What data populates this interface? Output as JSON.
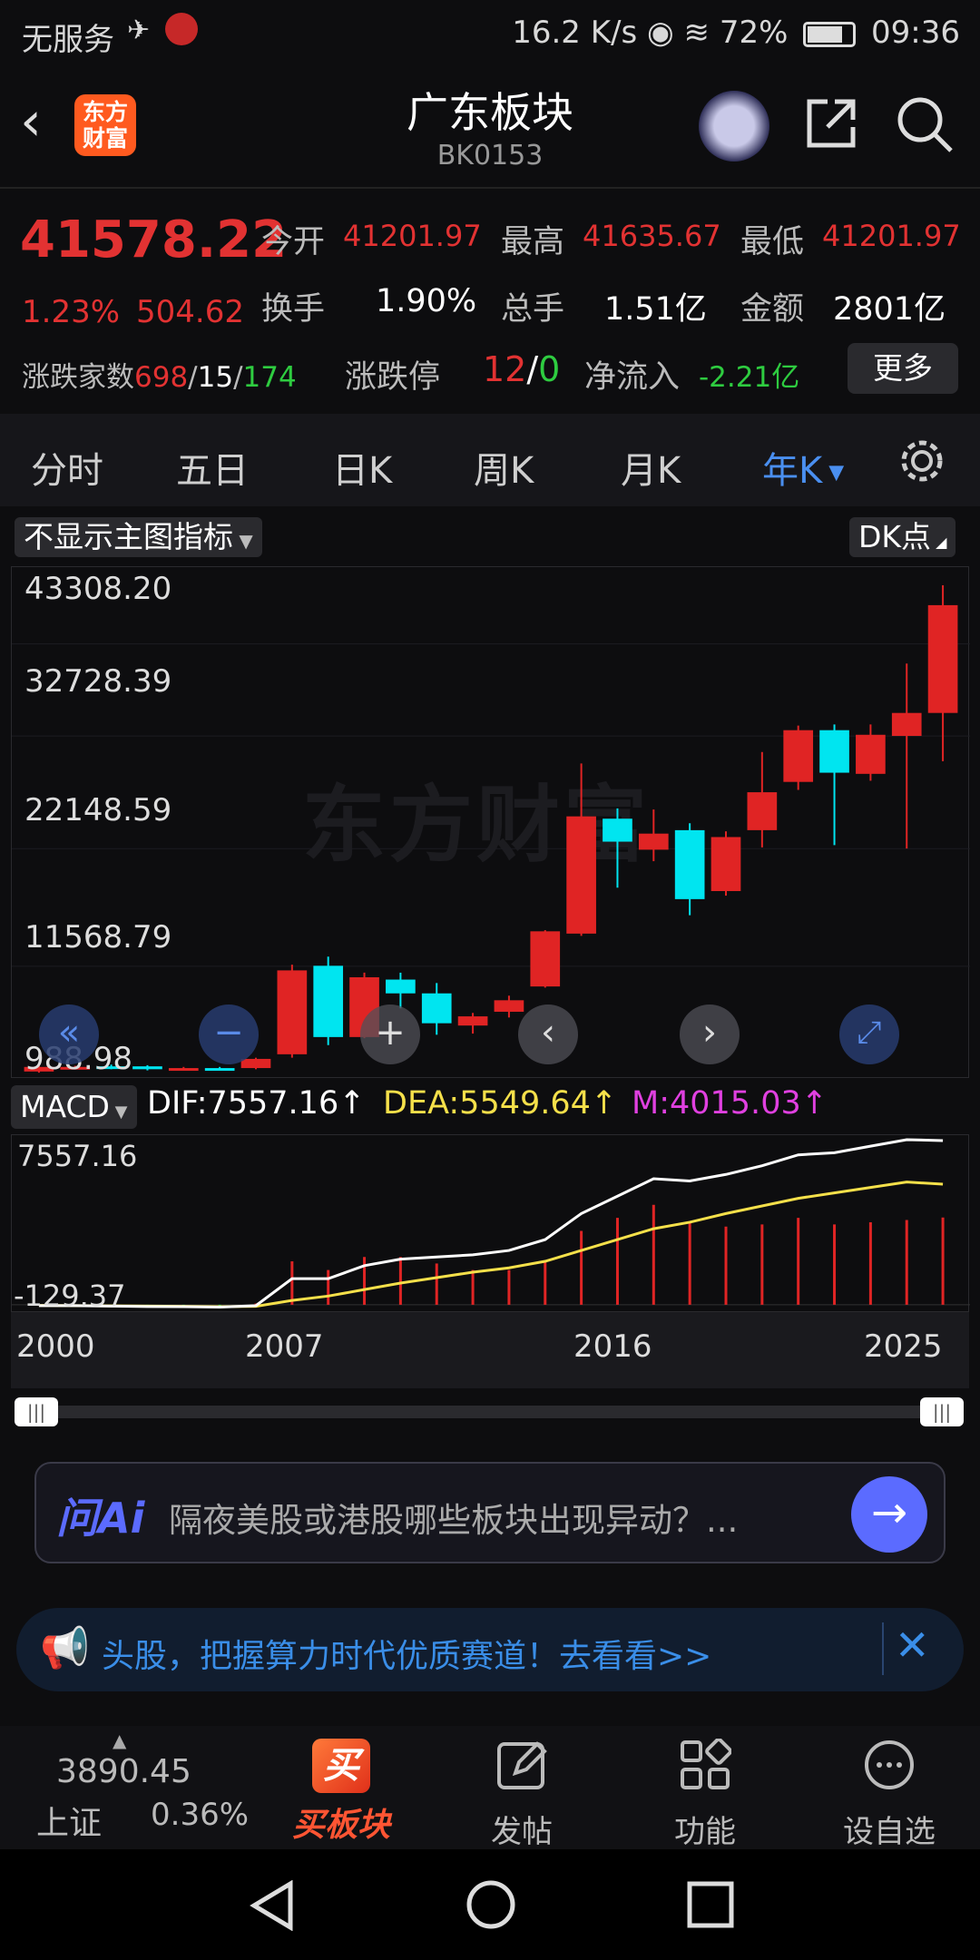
{
  "status": {
    "carrier": "无服务",
    "speed": "16.2 K/s",
    "battery": "72%",
    "time": "09:36"
  },
  "nav": {
    "logo": "东方财富",
    "title": "广东板块",
    "code": "BK0153"
  },
  "quote": {
    "price": "41578.22",
    "pct": "1.23%",
    "chg": "504.62",
    "open_label": "今开",
    "open": "41201.97",
    "high_label": "最高",
    "high": "41635.67",
    "low_label": "最低",
    "low": "41201.97",
    "turnover_label": "换手",
    "turnover": "1.90%",
    "vol_label": "总手",
    "vol": "1.51亿",
    "amt_label": "金额",
    "amt": "2801亿",
    "updown_label": "涨跌家数",
    "up": "698",
    "flat": "15",
    "down": "174",
    "limit_label": "涨跌停",
    "limit_up": "12",
    "limit_down": "0",
    "inflow_label": "净流入",
    "inflow": "-2.21亿",
    "more": "更多"
  },
  "tabs": [
    "分时",
    "五日",
    "日K",
    "周K",
    "月K",
    "年K"
  ],
  "chart": {
    "indicator_select": "不显示主图指标",
    "dk": "DK点",
    "watermark": "东方财富",
    "y_labels": [
      "43308.20",
      "32728.39",
      "22148.59",
      "11568.79",
      "988.98"
    ],
    "macd_select": "MACD",
    "dif": "DIF:7557.16",
    "dea": "DEA:5549.64",
    "m": "M:4015.03",
    "macd_top": "7557.16",
    "macd_bottom": "-129.37",
    "x_labels": [
      "2000",
      "2007",
      "2016",
      "2025"
    ]
  },
  "chart_data": {
    "type": "candlestick",
    "title": "",
    "x": [
      "2000",
      "2001",
      "2002",
      "2003",
      "2004",
      "2005",
      "2006",
      "2007",
      "2008",
      "2009",
      "2010",
      "2011",
      "2012",
      "2013",
      "2014",
      "2015",
      "2016",
      "2017",
      "2018",
      "2019",
      "2020",
      "2021",
      "2022",
      "2023",
      "2024",
      "2025"
    ],
    "ylim": [
      988.98,
      43308.2
    ],
    "candles": [
      {
        "o": 1000,
        "c": 1400,
        "h": 1500,
        "l": 900,
        "d": "up"
      },
      {
        "o": 1400,
        "c": 1300,
        "h": 1500,
        "l": 1200,
        "d": "up"
      },
      {
        "o": 1300,
        "c": 1450,
        "h": 1600,
        "l": 1200,
        "d": "down"
      },
      {
        "o": 1450,
        "c": 1200,
        "h": 1550,
        "l": 1100,
        "d": "down"
      },
      {
        "o": 1200,
        "c": 1300,
        "h": 1400,
        "l": 1100,
        "d": "up"
      },
      {
        "o": 1300,
        "c": 1280,
        "h": 1400,
        "l": 1150,
        "d": "down"
      },
      {
        "o": 1300,
        "c": 2100,
        "h": 2200,
        "l": 1200,
        "d": "up"
      },
      {
        "o": 2500,
        "c": 9800,
        "h": 10300,
        "l": 2200,
        "d": "up"
      },
      {
        "o": 10200,
        "c": 4000,
        "h": 11000,
        "l": 3300,
        "d": "down"
      },
      {
        "o": 4000,
        "c": 9200,
        "h": 9600,
        "l": 3900,
        "d": "up"
      },
      {
        "o": 9000,
        "c": 7800,
        "h": 9600,
        "l": 6500,
        "d": "down"
      },
      {
        "o": 7800,
        "c": 5200,
        "h": 8700,
        "l": 4200,
        "d": "down"
      },
      {
        "o": 5000,
        "c": 5800,
        "h": 6100,
        "l": 4300,
        "d": "up"
      },
      {
        "o": 6200,
        "c": 7200,
        "h": 7600,
        "l": 5700,
        "d": "up"
      },
      {
        "o": 8400,
        "c": 13200,
        "h": 13300,
        "l": 8300,
        "d": "up"
      },
      {
        "o": 13000,
        "c": 23200,
        "h": 27800,
        "l": 12800,
        "d": "up"
      },
      {
        "o": 23000,
        "c": 21000,
        "h": 23900,
        "l": 17000,
        "d": "down"
      },
      {
        "o": 20300,
        "c": 21700,
        "h": 23800,
        "l": 19300,
        "d": "up"
      },
      {
        "o": 22000,
        "c": 16000,
        "h": 22600,
        "l": 14600,
        "d": "down"
      },
      {
        "o": 16700,
        "c": 21400,
        "h": 21900,
        "l": 16300,
        "d": "up"
      },
      {
        "o": 22000,
        "c": 25300,
        "h": 28800,
        "l": 20500,
        "d": "up"
      },
      {
        "o": 26200,
        "c": 30700,
        "h": 31100,
        "l": 25500,
        "d": "up"
      },
      {
        "o": 30700,
        "c": 27000,
        "h": 31200,
        "l": 20700,
        "d": "down"
      },
      {
        "o": 26900,
        "c": 30300,
        "h": 31200,
        "l": 26300,
        "d": "up"
      },
      {
        "o": 30200,
        "c": 32200,
        "h": 36500,
        "l": 20400,
        "d": "up"
      },
      {
        "o": 32200,
        "c": 41578.22,
        "h": 43308.2,
        "l": 28000,
        "d": "up"
      }
    ],
    "macd": {
      "dif": [
        -40,
        -40,
        -60,
        -80,
        -90,
        -110,
        -40,
        1200,
        1200,
        1800,
        2100,
        2200,
        2300,
        2500,
        3000,
        4200,
        5000,
        5800,
        5700,
        6000,
        6400,
        6900,
        7000,
        7300,
        7600,
        7557.16
      ],
      "dea": [
        -30,
        -40,
        -50,
        -60,
        -70,
        -90,
        -70,
        200,
        400,
        700,
        1000,
        1250,
        1500,
        1700,
        2000,
        2500,
        3000,
        3500,
        3800,
        4200,
        4550,
        4900,
        5150,
        5400,
        5650,
        5549.64
      ],
      "ylim": [
        -129.37,
        7557.16
      ]
    }
  },
  "ai": {
    "logo": "问Ai",
    "placeholder": "隔夜美股或港股哪些板块出现异动？..."
  },
  "notice": {
    "text": "头股，把握算力时代优质赛道！去看看>>"
  },
  "bottom": {
    "index_value": "3890.45",
    "index_name": "上证",
    "index_pct": "0.36%",
    "buy": "买板块",
    "post": "发帖",
    "func": "功能",
    "watch": "设自选"
  }
}
